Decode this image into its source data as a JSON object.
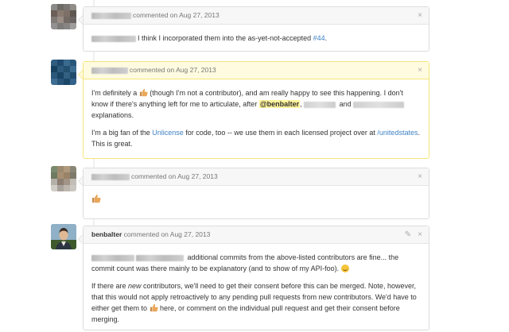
{
  "comments": [
    {
      "action": "commented on",
      "date": "Aug 27, 2013",
      "body": {
        "text_a": "I think I incorporated them into the as-yet-not-accepted ",
        "issue_link": "#44",
        "text_b": "."
      }
    },
    {
      "action": "commented on",
      "date": "Aug 27, 2013",
      "p1": {
        "a": "I'm definitely a ",
        "b": " (though I'm not a contributor), and am really happy to see this happening. I don't know if there's anything left for me to articulate, after ",
        "mention": "@benbalter",
        "c": ", ",
        "d": " and ",
        "e": " explanations."
      },
      "p2": {
        "a": "I'm a big fan of the ",
        "link1": "Unlicense",
        "b": " for code, too -- we use them in each licensed project over at ",
        "link2": "/unitedstates",
        "c": ". This is great."
      }
    },
    {
      "action": "commented on",
      "date": "Aug 27, 2013"
    },
    {
      "author": "benbalter",
      "action": "commented on",
      "date": "Aug 27, 2013",
      "p1": {
        "a": " additional commits from the above-listed contributors are fine... the commit count was there mainly to be explanatory (and to show of my API-foo). "
      },
      "p2": {
        "a": "If there are ",
        "em": "new",
        "b": " contributors, we'll need to get their consent before this can be merged. Note, however, that this would not apply retroactively to any pending pull requests from new contributors. We'd have to either get them to ",
        "c": " here, or comment on the individual pull request and get their consent before merging."
      }
    }
  ],
  "icons": {
    "close": "×",
    "edit": "✎"
  },
  "colors": {
    "link": "#4183c4",
    "mention_highlight": "#fff39a",
    "highlight_border": "#f5e57a"
  }
}
